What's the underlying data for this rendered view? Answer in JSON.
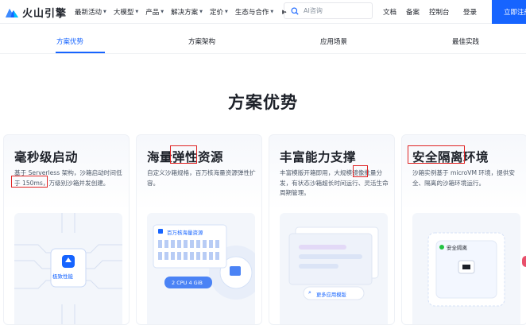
{
  "header": {
    "logo_text": "火山引擎",
    "nav": [
      {
        "label": "最新活动"
      },
      {
        "label": "大模型"
      },
      {
        "label": "产品"
      },
      {
        "label": "解决方案"
      },
      {
        "label": "定价"
      },
      {
        "label": "生态与合作"
      }
    ],
    "search_placeholder": "AI咨询",
    "links": [
      "文档",
      "备案",
      "控制台"
    ],
    "login": "登录",
    "cta": "立即注册"
  },
  "tabs": [
    {
      "label": "方案优势",
      "active": true
    },
    {
      "label": "方案架构",
      "active": false
    },
    {
      "label": "应用场景",
      "active": false
    },
    {
      "label": "最佳实践",
      "active": false
    }
  ],
  "section_title": "方案优势",
  "cards": [
    {
      "title": "毫秒级启动",
      "desc": "基于 Serverless 架构，沙箱启动时间低于 150ms，万级别沙箱并发创建。",
      "art_label": "极致性能"
    },
    {
      "title": "海量弹性资源",
      "desc": "自定义沙箱规格，百万核海量资源弹性扩容。",
      "art_label": "百万核海量资源",
      "art_label2": "2 CPU 4 GiB"
    },
    {
      "title": "丰富能力支撑",
      "desc": "丰富模版开箱即用，大规模镜像批量分发，有状态沙箱超长时间运行、灵活生命周期管理。",
      "art_label": "更多应用模版"
    },
    {
      "title": "安全隔离环境",
      "desc": "沙箱实例基于 microVM 环境，提供安全、隔离的沙箱环境运行。",
      "art_label": "安全隔离"
    }
  ],
  "colors": {
    "brand": "#1664ff",
    "highlight": "#e02424"
  }
}
